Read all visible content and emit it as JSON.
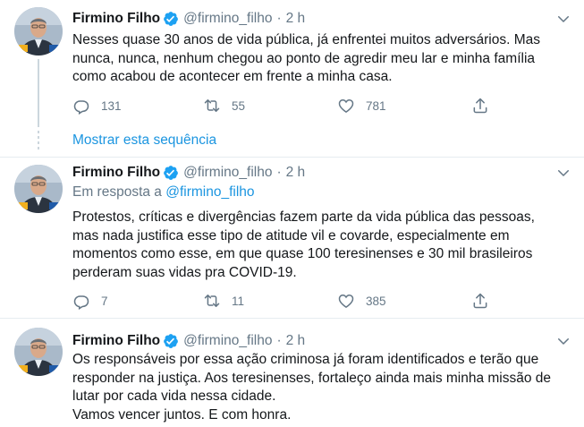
{
  "colors": {
    "accent": "#1b95e0",
    "muted": "#657786",
    "text": "#14171a",
    "border": "#e6ecf0"
  },
  "thread": {
    "show_label": "Mostrar esta sequência"
  },
  "tweets": [
    {
      "name": "Firmino Filho",
      "handle": "@firmino_filho",
      "dot": "·",
      "time": "2 h",
      "reply_prefix": "",
      "reply_handle": "",
      "lines": [
        "Nesses quase 30 anos de vida pública, já enfrentei muitos adversários. Mas",
        "nunca, nunca, nenhum chegou ao ponto de agredir meu lar e minha família",
        "como acabou de acontecer em frente a minha casa."
      ],
      "replies": "131",
      "retweets": "55",
      "likes": "781"
    },
    {
      "name": "Firmino Filho",
      "handle": "@firmino_filho",
      "dot": "·",
      "time": "2 h",
      "reply_prefix": "Em resposta a ",
      "reply_handle": "@firmino_filho",
      "lines": [
        "Protestos, críticas e divergências fazem parte da vida pública das pessoas,",
        "mas nada justifica esse tipo de atitude vil e covarde, especialmente em",
        "momentos como esse, em que quase 100 teresinenses e 30 mil brasileiros",
        "perderam suas vidas pra COVID-19."
      ],
      "replies": "7",
      "retweets": "11",
      "likes": "385"
    },
    {
      "name": "Firmino Filho",
      "handle": "@firmino_filho",
      "dot": "·",
      "time": "2 h",
      "reply_prefix": "",
      "reply_handle": "",
      "lines": [
        "Os responsáveis por essa ação criminosa já foram identificados e terão que",
        "responder na justiça. Aos teresinenses, fortaleço ainda mais minha missão de",
        "lutar por cada vida nessa cidade.",
        "Vamos vencer juntos. E com honra."
      ]
    }
  ]
}
